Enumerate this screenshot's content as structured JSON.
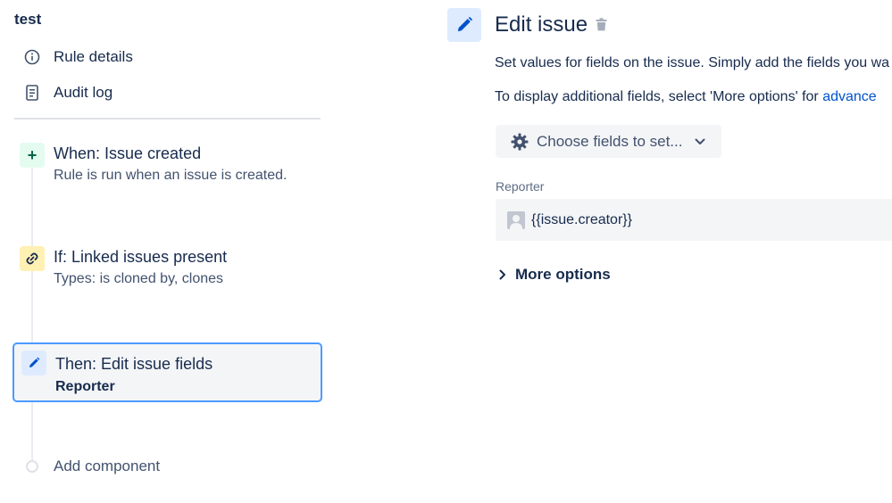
{
  "sidebar": {
    "rule_name": "test",
    "nav": [
      {
        "label": "Rule details",
        "icon": "info-icon"
      },
      {
        "label": "Audit log",
        "icon": "document-icon"
      }
    ],
    "components": [
      {
        "title": "When: Issue created",
        "subtitle": "Rule is run when an issue is created.",
        "icon": "plus-icon",
        "color": "#006644"
      },
      {
        "title": "If: Linked issues present",
        "subtitle": "Types: is cloned by, clones",
        "icon": "link-icon",
        "color": "#ff991f"
      },
      {
        "title": "Then: Edit issue fields",
        "subtitle": "Reporter",
        "icon": "pencil-icon",
        "color": "#0052cc",
        "selected": true
      }
    ],
    "add_component": "Add component"
  },
  "panel": {
    "title": "Edit issue",
    "description_line1": "Set values for fields on the issue. Simply add the fields you wa",
    "description_line2_prefix": "To display additional fields, select 'More options' for ",
    "description_line2_link": "advance",
    "choose_fields_label": "Choose fields to set...",
    "fields": [
      {
        "label": "Reporter",
        "value": "{{issue.creator}}"
      }
    ],
    "more_options_label": "More options"
  },
  "colors": {
    "accent": "#0052cc",
    "selected_border": "#4c9aff",
    "text": "#172b4d"
  }
}
